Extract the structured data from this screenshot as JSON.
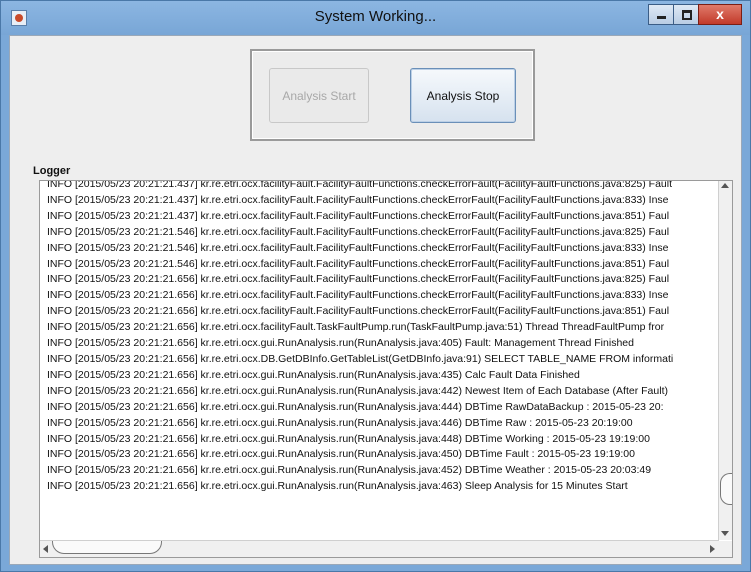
{
  "window": {
    "title": "System Working...",
    "icons": {
      "app": "java-app-icon",
      "minimize": "minimize-icon",
      "maximize": "maximize-icon",
      "close": "close-icon"
    },
    "close_glyph": "x"
  },
  "buttons": {
    "start_label": "Analysis Start",
    "stop_label": "Analysis Stop",
    "start_enabled": false,
    "stop_enabled": true
  },
  "logger": {
    "label": "Logger",
    "lines": [
      "INFO [2015/05/23 20:21:21.437] kr.re.etri.ocx.facilityFault.FacilityFaultFunctions.checkErrorFault(FacilityFaultFunctions.java:825) Fault",
      "INFO [2015/05/23 20:21:21.437] kr.re.etri.ocx.facilityFault.FacilityFaultFunctions.checkErrorFault(FacilityFaultFunctions.java:833) Inse",
      "INFO [2015/05/23 20:21:21.437] kr.re.etri.ocx.facilityFault.FacilityFaultFunctions.checkErrorFault(FacilityFaultFunctions.java:851) Faul",
      "INFO [2015/05/23 20:21:21.546] kr.re.etri.ocx.facilityFault.FacilityFaultFunctions.checkErrorFault(FacilityFaultFunctions.java:825) Faul",
      "INFO [2015/05/23 20:21:21.546] kr.re.etri.ocx.facilityFault.FacilityFaultFunctions.checkErrorFault(FacilityFaultFunctions.java:833) Inse",
      "INFO [2015/05/23 20:21:21.546] kr.re.etri.ocx.facilityFault.FacilityFaultFunctions.checkErrorFault(FacilityFaultFunctions.java:851) Faul",
      "INFO [2015/05/23 20:21:21.656] kr.re.etri.ocx.facilityFault.FacilityFaultFunctions.checkErrorFault(FacilityFaultFunctions.java:825) Faul",
      "INFO [2015/05/23 20:21:21.656] kr.re.etri.ocx.facilityFault.FacilityFaultFunctions.checkErrorFault(FacilityFaultFunctions.java:833) Inse",
      "INFO [2015/05/23 20:21:21.656] kr.re.etri.ocx.facilityFault.FacilityFaultFunctions.checkErrorFault(FacilityFaultFunctions.java:851) Faul",
      "INFO [2015/05/23 20:21:21.656] kr.re.etri.ocx.facilityFault.TaskFaultPump.run(TaskFaultPump.java:51) Thread ThreadFaultPump fror",
      "INFO [2015/05/23 20:21:21.656] kr.re.etri.ocx.gui.RunAnalysis.run(RunAnalysis.java:405) Fault: Management Thread Finished",
      "INFO [2015/05/23 20:21:21.656] kr.re.etri.ocx.DB.GetDBInfo.GetTableList(GetDBInfo.java:91) SELECT TABLE_NAME FROM informati",
      "INFO [2015/05/23 20:21:21.656] kr.re.etri.ocx.gui.RunAnalysis.run(RunAnalysis.java:435) Calc Fault Data Finished",
      "INFO [2015/05/23 20:21:21.656] kr.re.etri.ocx.gui.RunAnalysis.run(RunAnalysis.java:442) Newest Item of Each Database (After Fault)",
      "INFO [2015/05/23 20:21:21.656] kr.re.etri.ocx.gui.RunAnalysis.run(RunAnalysis.java:444) DBTime RawDataBackup : 2015-05-23 20:",
      "INFO [2015/05/23 20:21:21.656] kr.re.etri.ocx.gui.RunAnalysis.run(RunAnalysis.java:446) DBTime Raw : 2015-05-23 20:19:00",
      "INFO [2015/05/23 20:21:21.656] kr.re.etri.ocx.gui.RunAnalysis.run(RunAnalysis.java:448) DBTime Working : 2015-05-23 19:19:00",
      "INFO [2015/05/23 20:21:21.656] kr.re.etri.ocx.gui.RunAnalysis.run(RunAnalysis.java:450) DBTime Fault : 2015-05-23 19:19:00",
      "INFO [2015/05/23 20:21:21.656] kr.re.etri.ocx.gui.RunAnalysis.run(RunAnalysis.java:452) DBTime Weather : 2015-05-23 20:03:49",
      "INFO [2015/05/23 20:21:21.656] kr.re.etri.ocx.gui.RunAnalysis.run(RunAnalysis.java:463) Sleep Analysis for 15 Minutes Start"
    ]
  },
  "colors": {
    "title_bar": "#78a6d6",
    "close_button": "#c23a2a",
    "panel_background": "#eeeeee"
  }
}
